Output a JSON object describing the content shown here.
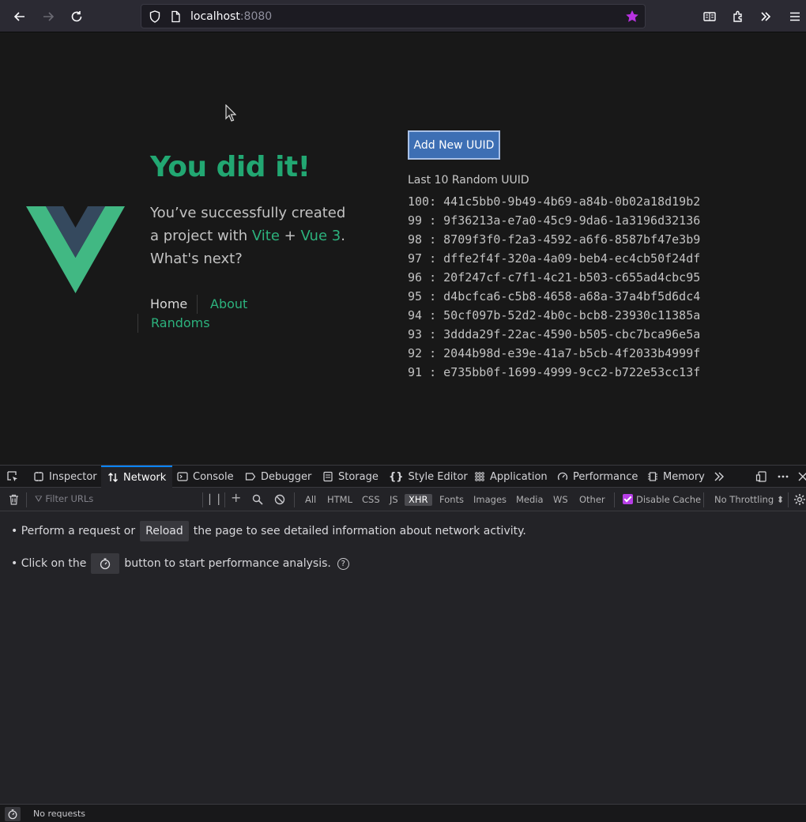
{
  "browser": {
    "url_host": "localhost",
    "url_port": ":8080",
    "accent_star": "#b833e1"
  },
  "page": {
    "title": "You did it!",
    "intro_prefix": "You’ve successfully created a project with ",
    "vite_link": "Vite",
    "plus": " + ",
    "vue_link": "Vue 3",
    "intro_suffix": ". What's next?",
    "nav": {
      "home": "Home",
      "about": "About",
      "randoms": "Randoms"
    },
    "add_button": "Add New UUID",
    "list_heading": "Last 10 Random UUID",
    "uuids": [
      "100: 441c5bb0-9b49-4b69-a84b-0b02a18d19b2",
      "99 : 9f36213a-e7a0-45c9-9da6-1a3196d32136",
      "98 : 8709f3f0-f2a3-4592-a6f6-8587bf47e3b9",
      "97 : dffe2f4f-320a-4a09-beb4-ec4cb50f24df",
      "96 : 20f247cf-c7f1-4c21-b503-c655ad4cbc95",
      "95 : d4bcfca6-c5b8-4658-a68a-37a4bf5d6dc4",
      "94 : 50cf097b-52d2-4b0c-bcb8-23930c11385a",
      "93 : 3ddda29f-22ac-4590-b505-cbc7bca96e5a",
      "92 : 2044b98d-e39e-41a7-b5cb-4f2033b4999f",
      "91 : e735bb0f-1699-4999-9cc2-b722e53cc13f"
    ]
  },
  "devtools": {
    "tabs": [
      "Inspector",
      "Network",
      "Console",
      "Debugger",
      "Storage",
      "Style Editor",
      "Application",
      "Performance",
      "Memory"
    ],
    "active_tab": "Network",
    "filter_placeholder": "Filter URLs",
    "types": [
      "All",
      "HTML",
      "CSS",
      "JS",
      "XHR",
      "Fonts",
      "Images",
      "Media",
      "WS",
      "Other"
    ],
    "active_type": "XHR",
    "disable_cache": "Disable Cache",
    "throttling": "No Throttling ⬍",
    "msg1_prefix": "• Perform a request or",
    "msg1_button": "Reload",
    "msg1_suffix": "the page to see detailed information about network activity.",
    "msg2_prefix": "• Click on the",
    "msg2_suffix": "button to start performance analysis.",
    "help": "?",
    "status": "No requests"
  }
}
